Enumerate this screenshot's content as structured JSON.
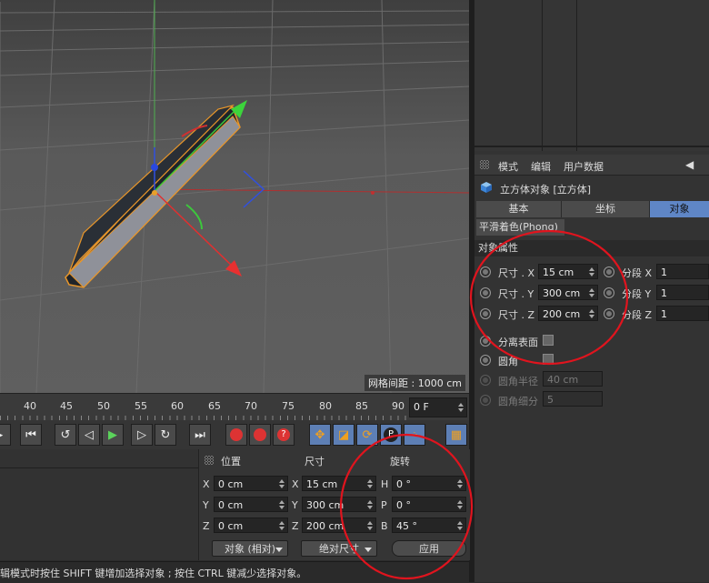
{
  "viewport": {
    "grid_spacing": "网格间距 : 1000 cm"
  },
  "attributes": {
    "menu": [
      "模式",
      "编辑",
      "用户数据"
    ],
    "object_title": "立方体对象 [立方体]",
    "tabs": [
      "基本",
      "坐标",
      "对象"
    ],
    "active_tab": "对象",
    "phong_tab": "平滑着色(Phong)",
    "section": "对象属性",
    "size_rows": [
      {
        "label": "尺寸 . X",
        "value": "15 cm",
        "seg_label": "分段 X",
        "seg_value": "1"
      },
      {
        "label": "尺寸 . Y",
        "value": "300 cm",
        "seg_label": "分段 Y",
        "seg_value": "1"
      },
      {
        "label": "尺寸 . Z",
        "value": "200 cm",
        "seg_label": "分段 Z",
        "seg_value": "1"
      }
    ],
    "separate_surfaces": "分离表面",
    "fillet": "圆角",
    "fillet_radius_label": "圆角半径",
    "fillet_radius_value": "40 cm",
    "fillet_subdiv_label": "圆角细分",
    "fillet_subdiv_value": "5"
  },
  "timeline": {
    "ticks": [
      "40",
      "45",
      "50",
      "55",
      "60",
      "65",
      "70",
      "75",
      "80",
      "85",
      "90"
    ],
    "current_frame": "0 F"
  },
  "coordinates": {
    "headers": {
      "position": "位置",
      "size": "尺寸",
      "rotation": "旋转"
    },
    "rows": [
      {
        "pos_axis": "X",
        "pos": "0 cm",
        "size_axis": "X",
        "size": "15 cm",
        "rot_axis": "H",
        "rot": "0 °"
      },
      {
        "pos_axis": "Y",
        "pos": "0 cm",
        "size_axis": "Y",
        "size": "300 cm",
        "rot_axis": "P",
        "rot": "0 °"
      },
      {
        "pos_axis": "Z",
        "pos": "0 cm",
        "size_axis": "Z",
        "size": "200 cm",
        "rot_axis": "B",
        "rot": "45 °"
      }
    ],
    "mode_dropdown": "对象 (相对)",
    "size_dropdown": "绝对尺寸",
    "apply_button": "应用"
  },
  "status_bar": "辑模式时按住 SHIFT 键增加选择对象 ; 按住 CTRL 键减少选择对象。",
  "colors": {
    "annotation_red": "#e0141e",
    "active_tab": "#5f86c6",
    "axis_x": "#e03030",
    "axis_y": "#3cc83c",
    "axis_z": "#3050e0",
    "object_outline": "#e8962a"
  }
}
